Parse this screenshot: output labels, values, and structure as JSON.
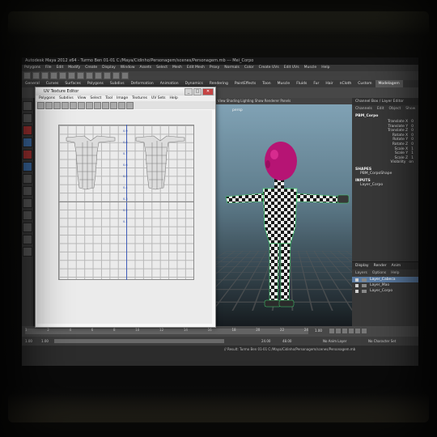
{
  "app": {
    "title": "Autodesk Maya 2012 x64 - Turmo Ben 01-01 C:/Maya/Cidinho/Personagem/scenes/Personagem.mb --- Mei_Corpo",
    "menus": [
      "Polygons",
      "File",
      "Edit",
      "Modify",
      "Create",
      "Display",
      "Window",
      "Assets",
      "Select",
      "Mesh",
      "Edit Mesh",
      "Proxy",
      "Normals",
      "Color",
      "Create UVs",
      "Edit UVs",
      "Muscle",
      "Help"
    ],
    "shelf_tabs": [
      "General",
      "Curves",
      "Surfaces",
      "Polygons",
      "Subdivs",
      "Deformation",
      "Animation",
      "Dynamics",
      "Rendering",
      "PaintEffects",
      "Toon",
      "Muscle",
      "Fluids",
      "Fur",
      "Hair",
      "nCloth",
      "Custom",
      "Modelagem"
    ],
    "shelf_active_tab": "Modelagem"
  },
  "uv_editor": {
    "title": "UV Texture Editor",
    "menus": [
      "Polygons",
      "Subdivs",
      "View",
      "Select",
      "Tool",
      "Image",
      "Textures",
      "UV Sets",
      "Help"
    ],
    "axis_labels": [
      "0.9",
      "0.8",
      "0.7",
      "0.6",
      "0.5",
      "0.4",
      "0.3",
      "0.2",
      "0.1"
    ],
    "window_buttons": {
      "minimize": "_",
      "maximize": "□",
      "close": "✕"
    }
  },
  "viewport": {
    "menu": "View  Shading  Lighting  Show  Renderer  Panels",
    "label": "persp"
  },
  "channel_box": {
    "header": "Channel Box / Layer Editor",
    "tabs": [
      "Channels",
      "Edit",
      "Object",
      "Show"
    ],
    "object_name": "PBM_Corpo",
    "attributes": [
      {
        "name": "Translate X",
        "value": "0"
      },
      {
        "name": "Translate Y",
        "value": "0"
      },
      {
        "name": "Translate Z",
        "value": "0"
      },
      {
        "name": "Rotate X",
        "value": "0"
      },
      {
        "name": "Rotate Y",
        "value": "0"
      },
      {
        "name": "Rotate Z",
        "value": "0"
      },
      {
        "name": "Scale X",
        "value": "1"
      },
      {
        "name": "Scale Y",
        "value": "1"
      },
      {
        "name": "Scale Z",
        "value": "1"
      },
      {
        "name": "Visibility",
        "value": "on"
      }
    ],
    "shapes_label": "SHAPES",
    "shape_name": "PBM_CorpoShape",
    "inputs_label": "INPUTS",
    "input_name": "Layer_Corpo"
  },
  "layer_editor": {
    "tabs": [
      "Display",
      "Render",
      "Anim"
    ],
    "menus": [
      "Layers",
      "Options",
      "Help"
    ],
    "layers": [
      {
        "name": "Layer_Cabeca",
        "selected": true
      },
      {
        "name": "Layer_Mao",
        "selected": false
      },
      {
        "name": "Layer_Corpo",
        "selected": false
      }
    ]
  },
  "timeline": {
    "ticks": [
      "1",
      "2",
      "4",
      "6",
      "8",
      "10",
      "12",
      "14",
      "16",
      "18",
      "20",
      "22",
      "24"
    ],
    "current_frame": "1.00"
  },
  "range": {
    "start": "1.00",
    "playback_start": "1.00",
    "playback_end": "24.00",
    "end": "48.00",
    "anim_layer": "No Anim Layer",
    "char_set": "No Character Set"
  },
  "command_line": {
    "help": "// Result: Turmo Ben 01-01 C:/Maya/Cidinho/Personagem/scenes/Personagem.mb"
  },
  "colors": {
    "maya_dark": "#2b2b2b",
    "selection_blue": "#5b7ea8",
    "head_magenta": "#c0157a",
    "wire_green": "#39d46a"
  }
}
